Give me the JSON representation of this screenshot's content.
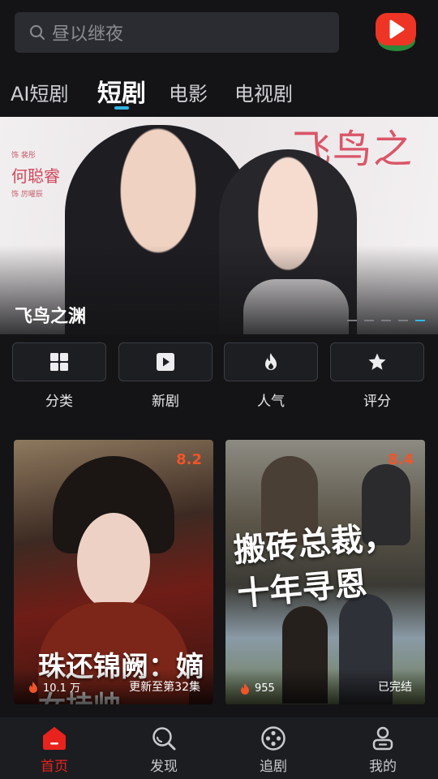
{
  "search": {
    "placeholder": "昼以继夜"
  },
  "tabs": [
    {
      "label": "AI短剧",
      "active": false
    },
    {
      "label": "短剧",
      "active": true
    },
    {
      "label": "电影",
      "active": false
    },
    {
      "label": "电视剧",
      "active": false
    }
  ],
  "banner": {
    "title": "飞鸟之渊",
    "script_title": "飞鸟之渊",
    "credit_actor": "何聪睿",
    "credit_top": "饰    裴彤",
    "credit_bottom": "饰    厉曜辰",
    "slide_count": 5,
    "active_slide": 5
  },
  "categories": [
    {
      "label": "分类",
      "icon": "grid-icon"
    },
    {
      "label": "新剧",
      "icon": "play-square-icon"
    },
    {
      "label": "人气",
      "icon": "flame-icon"
    },
    {
      "label": "评分",
      "icon": "star-icon"
    }
  ],
  "cards": [
    {
      "poster_title": "珠还锦阙：嫡女挂帅",
      "score": "8.2",
      "views": "10.1 万",
      "status": "更新至第32集"
    },
    {
      "poster_title": "搬砖总裁，十年寻恩",
      "score": "8.4",
      "views": "955",
      "status": "已完结"
    }
  ],
  "nav": [
    {
      "label": "首页",
      "icon": "home-icon",
      "active": true
    },
    {
      "label": "发现",
      "icon": "discover-icon",
      "active": false
    },
    {
      "label": "追剧",
      "icon": "follow-icon",
      "active": false
    },
    {
      "label": "我的",
      "icon": "profile-icon",
      "active": false
    }
  ],
  "colors": {
    "accent_blue": "#32b5e6",
    "brand_red": "#e8231e",
    "score_orange": "#f0552a"
  }
}
